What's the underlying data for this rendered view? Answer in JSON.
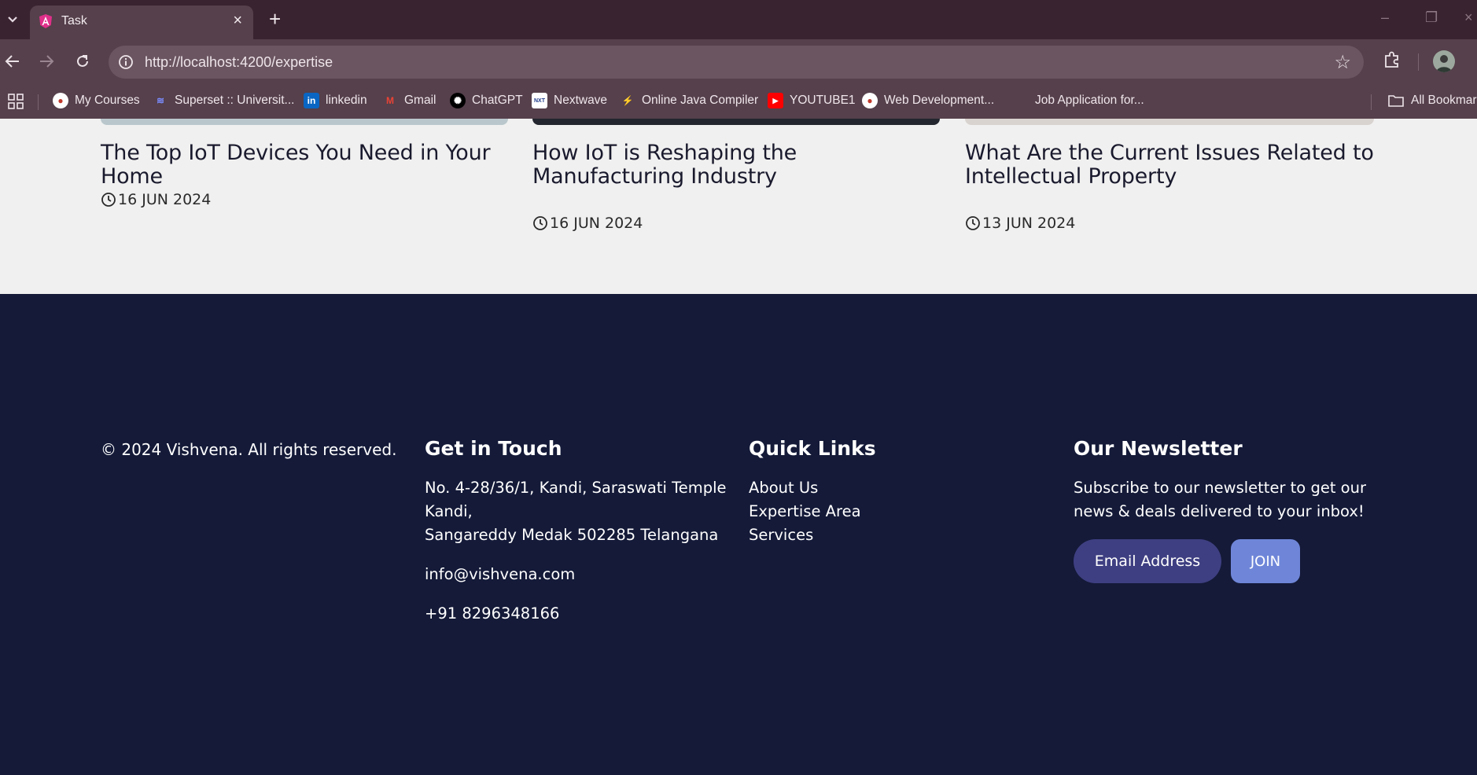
{
  "browser": {
    "tab_title": "Task",
    "url": "http://localhost:4200/expertise",
    "bookmarks": [
      {
        "label": "My Courses"
      },
      {
        "label": "Superset :: Universit..."
      },
      {
        "label": "linkedin"
      },
      {
        "label": "Gmail"
      },
      {
        "label": "ChatGPT"
      },
      {
        "label": "Nextwave"
      },
      {
        "label": "Online Java Compiler"
      },
      {
        "label": "YOUTUBE1"
      },
      {
        "label": "Web Development..."
      },
      {
        "label": "Job Application for..."
      }
    ],
    "all_bookmarks": "All Bookmarks"
  },
  "cards": [
    {
      "title": "The Top IoT Devices You Need in Your Home",
      "date": "16 JUN 2024"
    },
    {
      "title": "How IoT is Reshaping the Manufacturing Industry",
      "date": "16 JUN 2024"
    },
    {
      "title": "What Are the Current Issues Related to Intellectual Property",
      "date": "13 JUN 2024"
    }
  ],
  "footer": {
    "copyright": "© 2024 Vishvena. All rights reserved.",
    "contact": {
      "heading": "Get in Touch",
      "address_line1": "No. 4-28/36/1, Kandi, Saraswati Temple",
      "address_line2": "Kandi,",
      "address_line3": "Sangareddy Medak 502285 Telangana",
      "email": "info@vishvena.com",
      "phone": "+91 8296348166"
    },
    "quick_links": {
      "heading": "Quick Links",
      "items": [
        "About Us",
        "Expertise Area",
        "Services"
      ]
    },
    "newsletter": {
      "heading": "Our Newsletter",
      "text_line1": "Subscribe to our newsletter to get our",
      "text_line2": "news & deals delivered to your inbox!",
      "email_label": "Email Address",
      "join_label": "JOIN"
    }
  },
  "colors": {
    "footer_bg": "#141a38",
    "email_btn": "#3e3f82",
    "join_btn": "#6f86d8"
  }
}
